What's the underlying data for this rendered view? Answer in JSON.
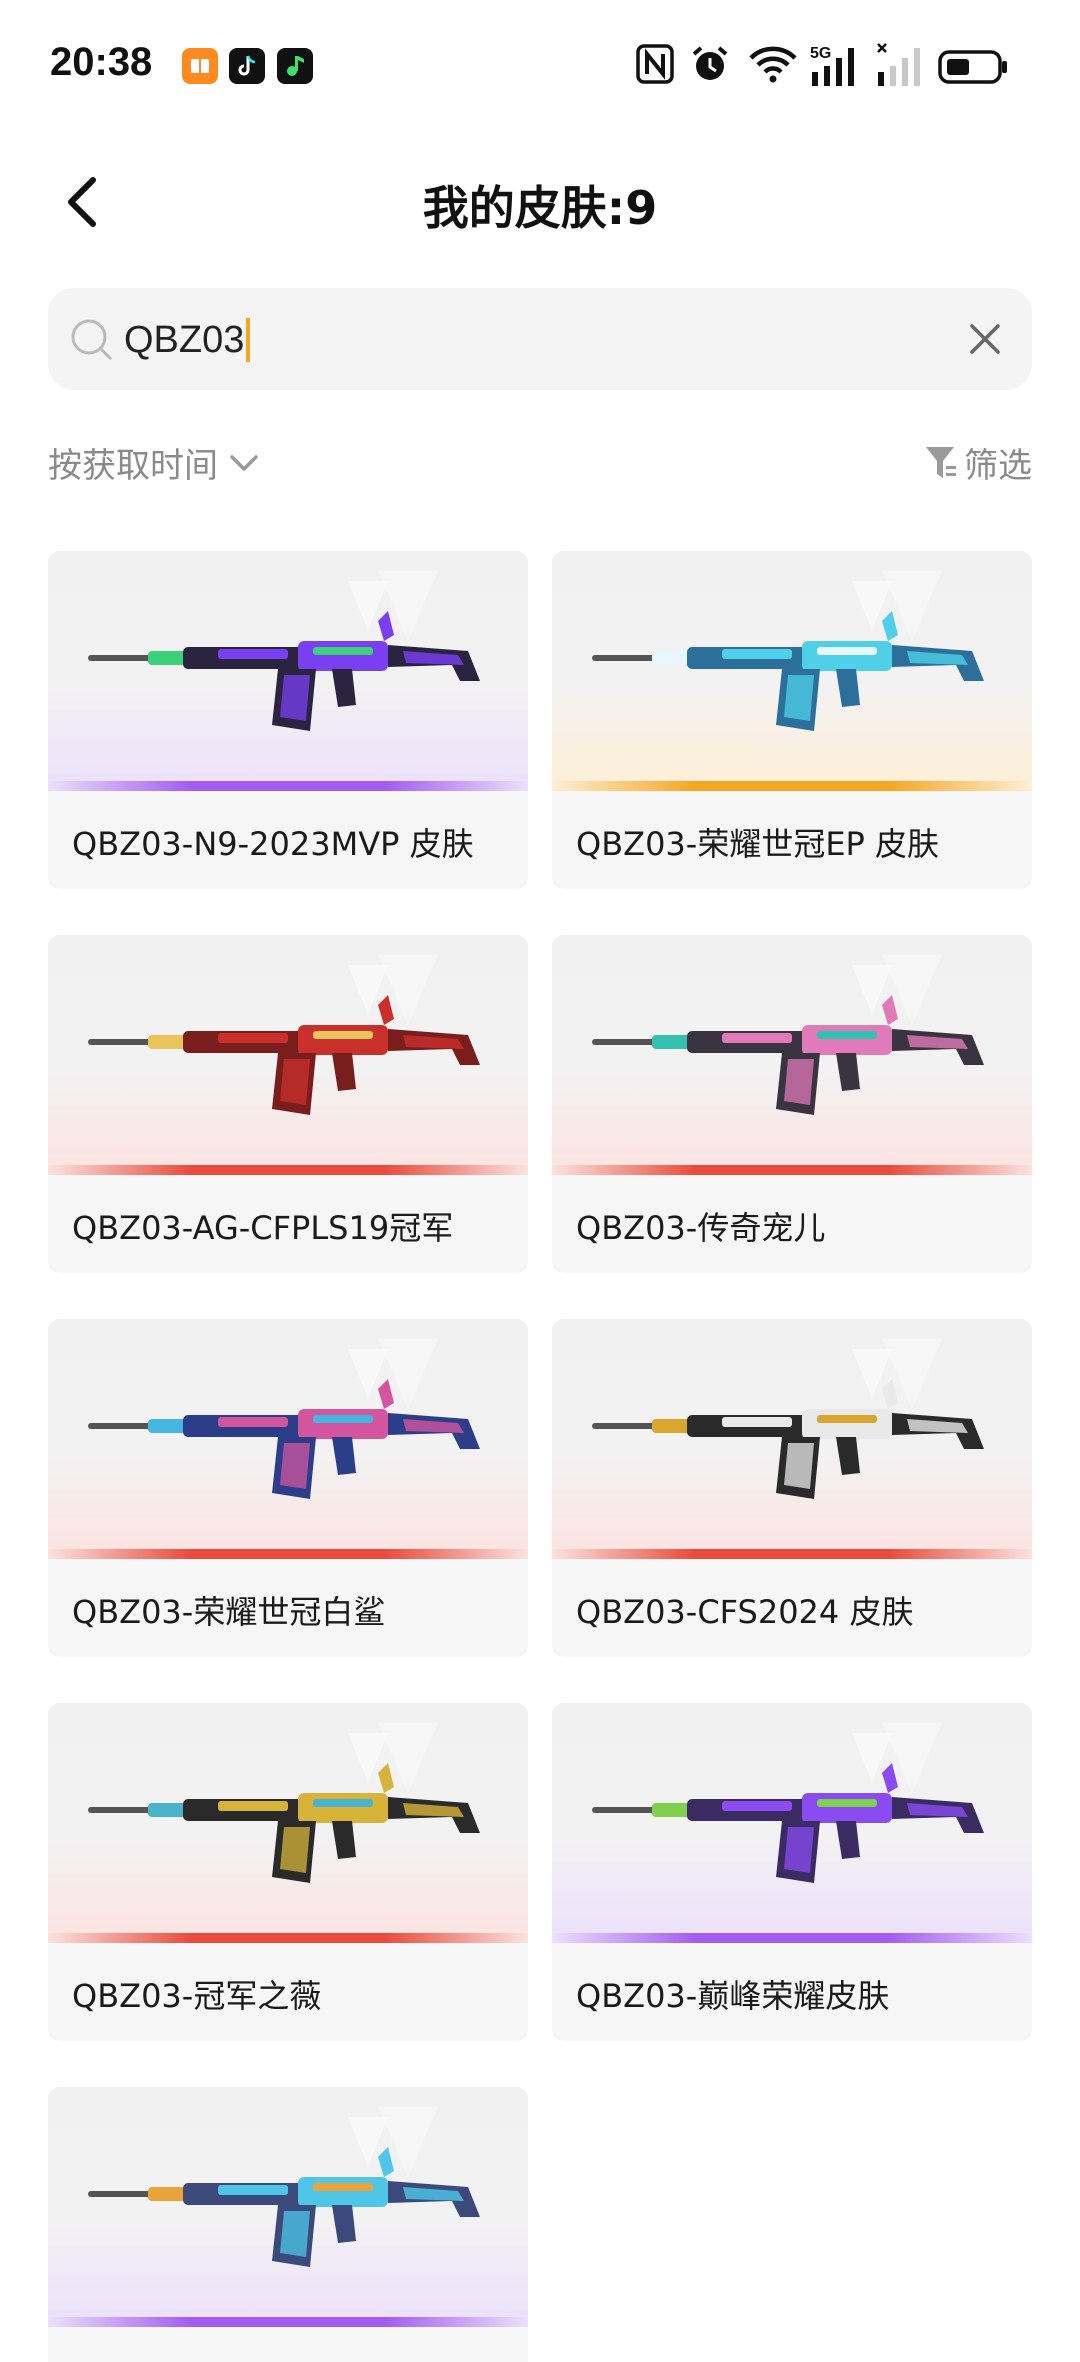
{
  "status_bar": {
    "time": "20:38",
    "app_icons": [
      "reader-app-icon",
      "tiktok-icon",
      "music-app-icon"
    ],
    "right_icons": [
      "nfc-icon",
      "alarm-icon",
      "wifi-icon",
      "signal-5g-icon",
      "signal-icon",
      "battery-icon"
    ],
    "network_label": "5G"
  },
  "header": {
    "title": "我的皮肤:9"
  },
  "search": {
    "value": "QBZ03"
  },
  "sort": {
    "label": "按获取时间"
  },
  "filter": {
    "label": "筛选"
  },
  "skins": [
    {
      "name": "QBZ03-N9-2023MVP 皮肤",
      "rarity_color": "#a25cf0",
      "glow": "#ece0fb",
      "gun": {
        "body": "#2a2440",
        "accent": "#7b3ff2",
        "accent2": "#3ad17a"
      }
    },
    {
      "name": "QBZ03-荣耀世冠EP 皮肤",
      "rarity_color": "#f5a623",
      "glow": "#fdefd6",
      "gun": {
        "body": "#2b6f9a",
        "accent": "#4fd0e8",
        "accent2": "#e8f6ff"
      }
    },
    {
      "name": "QBZ03-AG-CFPLS19冠军",
      "rarity_color": "#e84a3b",
      "glow": "#fbe3e0",
      "gun": {
        "body": "#7a1d1d",
        "accent": "#c9302c",
        "accent2": "#e8c45a"
      }
    },
    {
      "name": "QBZ03-传奇宠儿",
      "rarity_color": "#e84a3b",
      "glow": "#fbe3e0",
      "gun": {
        "body": "#3a3340",
        "accent": "#e07ab8",
        "accent2": "#33c2b0"
      }
    },
    {
      "name": "QBZ03-荣耀世冠白鲨",
      "rarity_color": "#e84a3b",
      "glow": "#fbe3e0",
      "gun": {
        "body": "#2c3e8a",
        "accent": "#d2559e",
        "accent2": "#45b6e0"
      }
    },
    {
      "name": "QBZ03-CFS2024 皮肤",
      "rarity_color": "#e84a3b",
      "glow": "#fbe3e0",
      "gun": {
        "body": "#2a2a2a",
        "accent": "#e9e9e9",
        "accent2": "#d9a72f"
      }
    },
    {
      "name": "QBZ03-冠军之薇",
      "rarity_color": "#e84a3b",
      "glow": "#fbe3e0",
      "gun": {
        "body": "#2a2a2a",
        "accent": "#d8b33a",
        "accent2": "#49b3c9"
      }
    },
    {
      "name": "QBZ03-巅峰荣耀皮肤",
      "rarity_color": "#a25cf0",
      "glow": "#ece0fb",
      "gun": {
        "body": "#3b2b63",
        "accent": "#8a4cf0",
        "accent2": "#7fd04e"
      }
    },
    {
      "name": "",
      "rarity_color": "#a25cf0",
      "glow": "#ece0fb",
      "gun": {
        "body": "#3b4a7a",
        "accent": "#4fc6e8",
        "accent2": "#e8a33a"
      }
    }
  ]
}
